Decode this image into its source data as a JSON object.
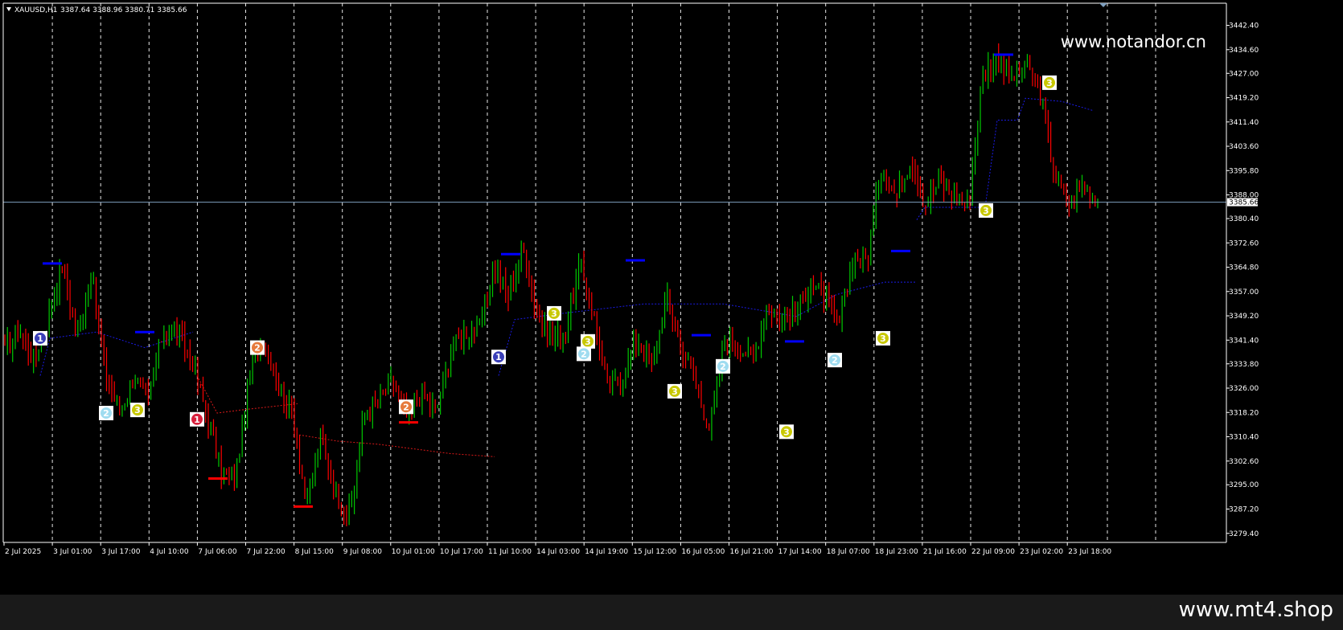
{
  "header": {
    "symbol": "XAUUSD,H1",
    "ohlc": "3387.64 3388.96 3380.71 3385.66"
  },
  "watermark": "www.notandor.cn",
  "footer_text": "www.mt4.shop",
  "current_price_label": "3385.66",
  "colors": {
    "background": "#000000",
    "bull": "#00c800",
    "bear": "#ff0000",
    "grid": "#ffffff",
    "axis_text": "#ffffff",
    "band": "#1a1ae6",
    "lower_band": "#d81818",
    "price_line": "#7f9fbf",
    "peak_marker": "#0000ff",
    "trough_marker": "#ff0000",
    "badge_1": "#3a3fb8",
    "badge_1_red": "#d8203c",
    "badge_2": "#9fdcf0",
    "badge_2_orange": "#e67a3c",
    "badge_3": "#c8c800"
  },
  "chart_data": {
    "type": "candlestick",
    "symbol": "XAUUSD",
    "timeframe": "H1",
    "ylim": [
      3276.5,
      3449.5
    ],
    "y_ticks": [
      "3442.40",
      "3434.60",
      "3427.00",
      "3419.20",
      "3411.40",
      "3403.60",
      "3395.80",
      "3388.00",
      "3380.40",
      "3372.60",
      "3364.80",
      "3357.00",
      "3349.20",
      "3341.40",
      "3333.80",
      "3326.00",
      "3318.20",
      "3310.40",
      "3302.60",
      "3295.00",
      "3287.20",
      "3279.40"
    ],
    "x_ticks": [
      "2 Jul 2025",
      "3 Jul 01:00",
      "3 Jul 17:00",
      "4 Jul 10:00",
      "7 Jul 06:00",
      "7 Jul 22:00",
      "8 Jul 15:00",
      "9 Jul 08:00",
      "10 Jul 01:00",
      "10 Jul 17:00",
      "11 Jul 10:00",
      "14 Jul 03:00",
      "14 Jul 19:00",
      "15 Jul 12:00",
      "16 Jul 05:00",
      "16 Jul 21:00",
      "17 Jul 14:00",
      "18 Jul 07:00",
      "18 Jul 23:00",
      "21 Jul 16:00",
      "22 Jul 09:00",
      "23 Jul 02:00",
      "23 Jul 18:00"
    ],
    "last_price": 3385.66,
    "anchor_prices": [
      3338,
      3345,
      3335,
      3348,
      3366,
      3342,
      3363,
      3330,
      3318,
      3330,
      3322,
      3345,
      3344,
      3335,
      3318,
      3300,
      3296,
      3330,
      3342,
      3328,
      3318,
      3288,
      3310,
      3292,
      3285,
      3318,
      3322,
      3328,
      3316,
      3325,
      3318,
      3338,
      3344,
      3345,
      3366,
      3355,
      3372,
      3350,
      3342,
      3345,
      3366,
      3348,
      3325,
      3330,
      3342,
      3332,
      3355,
      3340,
      3328,
      3313,
      3340,
      3340,
      3335,
      3352,
      3348,
      3350,
      3360,
      3355,
      3346,
      3368,
      3368,
      3398,
      3387,
      3400,
      3385,
      3392,
      3388,
      3385,
      3427,
      3432,
      3425,
      3430,
      3420,
      3395,
      3385,
      3391,
      3385
    ],
    "peak_markers": [
      3366,
      3344,
      3369,
      3367,
      3343,
      3341,
      3370,
      3433
    ],
    "trough_markers": [
      3297,
      3288,
      3315
    ],
    "badges": [
      {
        "label": "1",
        "price": 3342,
        "color": "badge_1"
      },
      {
        "label": "2",
        "price": 3318,
        "color": "badge_2"
      },
      {
        "label": "3",
        "price": 3319,
        "color": "badge_3"
      },
      {
        "label": "1",
        "price": 3316,
        "color": "badge_1_red"
      },
      {
        "label": "2",
        "price": 3339,
        "color": "badge_2_orange"
      },
      {
        "label": "2",
        "price": 3320,
        "color": "badge_2_orange"
      },
      {
        "label": "1",
        "price": 3336,
        "color": "badge_1"
      },
      {
        "label": "3",
        "price": 3350,
        "color": "badge_3"
      },
      {
        "label": "3",
        "price": 3341,
        "color": "badge_3"
      },
      {
        "label": "2",
        "price": 3337,
        "color": "badge_2"
      },
      {
        "label": "3",
        "price": 3325,
        "color": "badge_3"
      },
      {
        "label": "2",
        "price": 3333,
        "color": "badge_2"
      },
      {
        "label": "3",
        "price": 3312,
        "color": "badge_3"
      },
      {
        "label": "2",
        "price": 3335,
        "color": "badge_2"
      },
      {
        "label": "3",
        "price": 3342,
        "color": "badge_3"
      },
      {
        "label": "3",
        "price": 3383,
        "color": "badge_3"
      },
      {
        "label": "3",
        "price": 3424,
        "color": "badge_3"
      }
    ]
  }
}
